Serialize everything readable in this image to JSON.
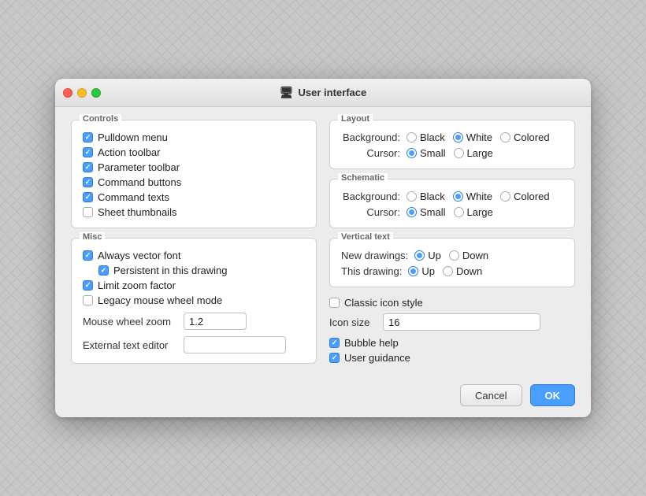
{
  "window": {
    "title": "User interface",
    "title_icon": "🖥"
  },
  "controls_group": {
    "label": "Controls",
    "checkboxes": [
      {
        "id": "pulldown-menu",
        "label": "Pulldown menu",
        "checked": true
      },
      {
        "id": "action-toolbar",
        "label": "Action toolbar",
        "checked": true
      },
      {
        "id": "parameter-toolbar",
        "label": "Parameter toolbar",
        "checked": true
      },
      {
        "id": "command-buttons",
        "label": "Command buttons",
        "checked": true
      },
      {
        "id": "command-texts",
        "label": "Command texts",
        "checked": true
      },
      {
        "id": "sheet-thumbnails",
        "label": "Sheet thumbnails",
        "checked": false
      }
    ]
  },
  "misc_group": {
    "label": "Misc",
    "checkboxes": [
      {
        "id": "always-vector-font",
        "label": "Always vector font",
        "checked": true,
        "indent": false
      },
      {
        "id": "persistent-in-drawing",
        "label": "Persistent in this drawing",
        "checked": true,
        "indent": true
      }
    ],
    "checkboxes2": [
      {
        "id": "limit-zoom-factor",
        "label": "Limit zoom factor",
        "checked": true
      },
      {
        "id": "legacy-mouse-wheel",
        "label": "Legacy mouse wheel mode",
        "checked": false
      }
    ],
    "mouse_wheel_zoom_label": "Mouse wheel zoom",
    "mouse_wheel_zoom_value": "1.2",
    "external_text_editor_label": "External text editor",
    "external_text_editor_value": ""
  },
  "layout_group": {
    "label": "Layout",
    "background_label": "Background:",
    "background_options": [
      {
        "label": "Black",
        "selected": false
      },
      {
        "label": "White",
        "selected": true
      },
      {
        "label": "Colored",
        "selected": false
      }
    ],
    "cursor_label": "Cursor:",
    "cursor_options": [
      {
        "label": "Small",
        "selected": true
      },
      {
        "label": "Large",
        "selected": false
      }
    ]
  },
  "schematic_group": {
    "label": "Schematic",
    "background_label": "Background:",
    "background_options": [
      {
        "label": "Black",
        "selected": false
      },
      {
        "label": "White",
        "selected": true
      },
      {
        "label": "Colored",
        "selected": false
      }
    ],
    "cursor_label": "Cursor:",
    "cursor_options": [
      {
        "label": "Small",
        "selected": true
      },
      {
        "label": "Large",
        "selected": false
      }
    ]
  },
  "vertical_text_group": {
    "label": "Vertical text",
    "new_drawings_label": "New drawings:",
    "new_drawings_options": [
      {
        "label": "Up",
        "selected": true
      },
      {
        "label": "Down",
        "selected": false
      }
    ],
    "this_drawing_label": "This drawing:",
    "this_drawing_options": [
      {
        "label": "Up",
        "selected": true
      },
      {
        "label": "Down",
        "selected": false
      }
    ]
  },
  "bottom_right": {
    "classic_icon_style_label": "Classic icon style",
    "classic_icon_style_checked": false,
    "icon_size_label": "Icon size",
    "icon_size_value": "16",
    "bubble_help_label": "Bubble help",
    "bubble_help_checked": true,
    "user_guidance_label": "User guidance",
    "user_guidance_checked": true
  },
  "buttons": {
    "cancel_label": "Cancel",
    "ok_label": "OK"
  }
}
